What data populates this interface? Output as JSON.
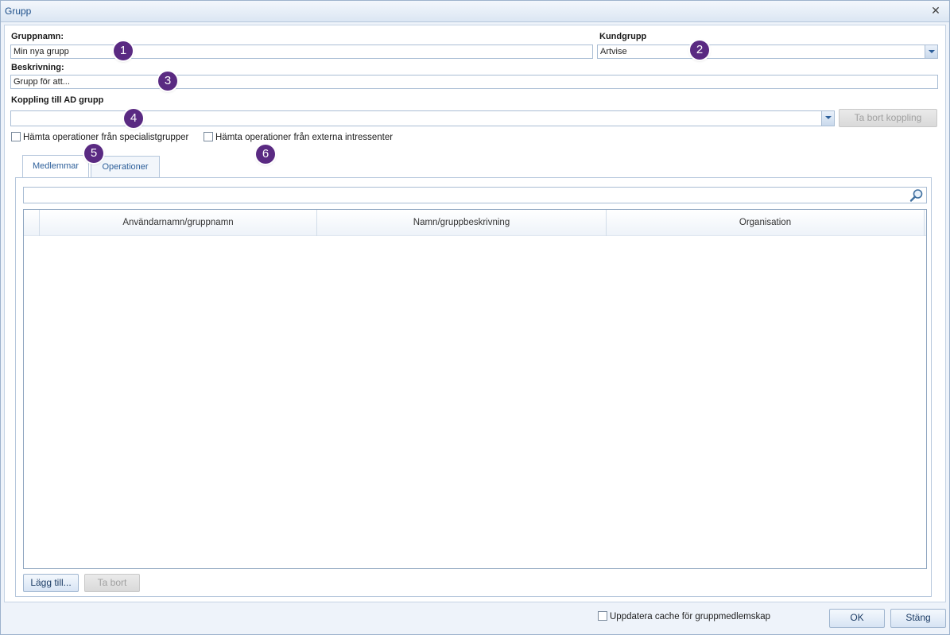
{
  "window": {
    "title": "Grupp",
    "close_icon": "close-icon"
  },
  "form": {
    "group_name": {
      "label": "Gruppnamn:",
      "value": "Min nya grupp"
    },
    "customer_group": {
      "label": "Kundgrupp",
      "value": "Artvise"
    },
    "description": {
      "label": "Beskrivning:",
      "value": "Grupp för att..."
    },
    "ad_link": {
      "label": "Koppling till AD grupp",
      "value": "",
      "remove_button": "Ta bort koppling"
    },
    "checkbox_specialist": {
      "label": "Hämta operationer från specialistgrupper",
      "checked": false
    },
    "checkbox_external": {
      "label": "Hämta operationer från externa intressenter",
      "checked": false
    }
  },
  "tabs": [
    {
      "label": "Medlemmar",
      "active": true
    },
    {
      "label": "Operationer",
      "active": false
    }
  ],
  "members": {
    "search_placeholder": "",
    "columns": [
      "Användarnamn/gruppnamn",
      "Namn/gruppbeskrivning",
      "Organisation"
    ],
    "rows": [],
    "add_button": "Lägg till...",
    "remove_button": "Ta bort"
  },
  "footer": {
    "cache_checkbox": {
      "label": "Uppdatera cache för gruppmedlemskap",
      "checked": false
    },
    "ok_button": "OK",
    "close_button": "Stäng"
  },
  "badges": [
    "1",
    "2",
    "3",
    "4",
    "5",
    "6"
  ],
  "colors": {
    "badge": "#5a2a82",
    "accent": "#2d5f9a"
  }
}
